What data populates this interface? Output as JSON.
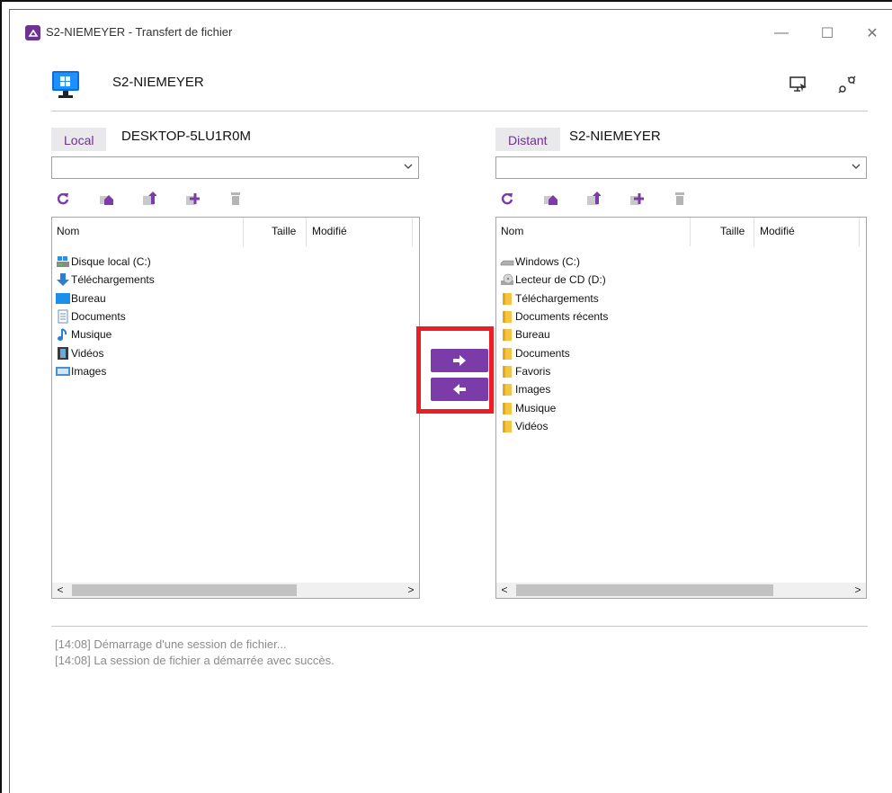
{
  "window": {
    "title": "S2-NIEMEYER - Transfert de fichier",
    "controls": {
      "minimize": "—",
      "maximize": "☐",
      "close": "✕"
    }
  },
  "header": {
    "host": "S2-NIEMEYER",
    "icons": [
      "monitor-windows-icon",
      "remote-screen-icon",
      "disconnect-plug-icon"
    ]
  },
  "local": {
    "tag": "Local",
    "host": "DESKTOP-5LU1R0M",
    "path_value": "",
    "toolbar": [
      "refresh-icon",
      "home-folder-icon",
      "parent-folder-icon",
      "new-folder-icon",
      "delete-icon"
    ],
    "columns": {
      "name": "Nom",
      "size": "Taille",
      "modified": "Modifié"
    },
    "items": [
      {
        "label": "Disque local (C:)",
        "icon": "local-disk-icon"
      },
      {
        "label": "Téléchargements",
        "icon": "download-arrow-icon"
      },
      {
        "label": "Bureau",
        "icon": "desktop-icon"
      },
      {
        "label": "Documents",
        "icon": "document-icon"
      },
      {
        "label": "Musique",
        "icon": "music-note-icon"
      },
      {
        "label": "Vidéos",
        "icon": "video-film-icon"
      },
      {
        "label": "Images",
        "icon": "image-icon"
      }
    ]
  },
  "remote": {
    "tag": "Distant",
    "host": "S2-NIEMEYER",
    "path_value": "",
    "toolbar": [
      "refresh-icon",
      "home-folder-icon",
      "parent-folder-icon",
      "new-folder-icon",
      "delete-icon"
    ],
    "columns": {
      "name": "Nom",
      "size": "Taille",
      "modified": "Modifié"
    },
    "items": [
      {
        "label": "Windows (C:)",
        "icon": "drive-icon"
      },
      {
        "label": "Lecteur de CD (D:)",
        "icon": "cd-drive-icon"
      },
      {
        "label": "Téléchargements",
        "icon": "folder-icon"
      },
      {
        "label": "Documents récents",
        "icon": "folder-icon"
      },
      {
        "label": "Bureau",
        "icon": "folder-icon"
      },
      {
        "label": "Documents",
        "icon": "folder-icon"
      },
      {
        "label": "Favoris",
        "icon": "folder-icon"
      },
      {
        "label": "Images",
        "icon": "folder-icon"
      },
      {
        "label": "Musique",
        "icon": "folder-icon"
      },
      {
        "label": "Vidéos",
        "icon": "folder-icon"
      }
    ]
  },
  "transfer": {
    "upload_icon": "arrow-right-icon",
    "download_icon": "arrow-left-icon",
    "highlight_color": "#ee1c25",
    "button_color": "#7b3ba8"
  },
  "scroll": {
    "left_arrow": "<",
    "right_arrow": ">"
  },
  "log": [
    "[14:08] Démarrage d'une session de fichier...",
    "[14:08] La session de fichier a démarrée avec succès."
  ],
  "accent_color": "#6c3390"
}
